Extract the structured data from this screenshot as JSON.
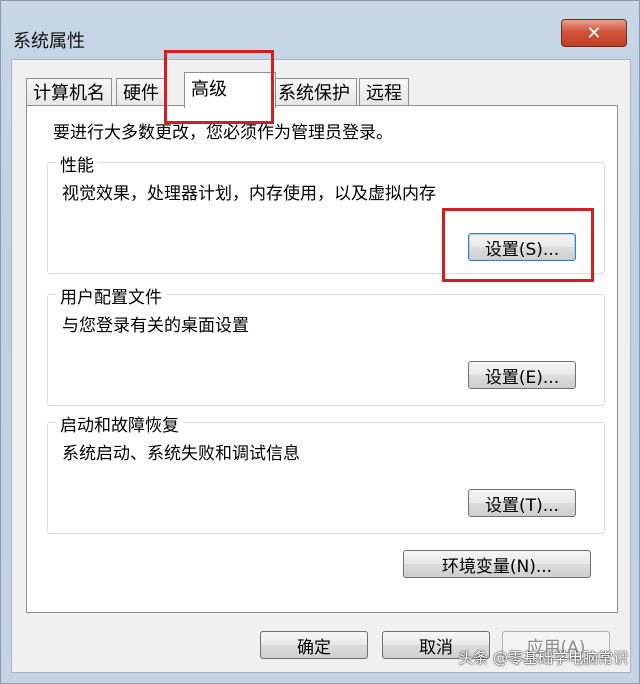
{
  "window": {
    "title": "系统属性",
    "close_glyph": "✕"
  },
  "tabs": [
    {
      "label": "计算机名",
      "active": false
    },
    {
      "label": "硬件",
      "active": false
    },
    {
      "label": "高级",
      "active": true
    },
    {
      "label": "系统保护",
      "active": false
    },
    {
      "label": "远程",
      "active": false
    }
  ],
  "advanced": {
    "admin_note": "要进行大多数更改，您必须作为管理员登录。",
    "performance": {
      "title": "性能",
      "description": "视觉效果，处理器计划，内存使用，以及虚拟内存",
      "button_label": "设置(S)..."
    },
    "user_profiles": {
      "title": "用户配置文件",
      "description": "与您登录有关的桌面设置",
      "button_label": "设置(E)..."
    },
    "startup_recovery": {
      "title": "启动和故障恢复",
      "description": "系统启动、系统失败和调试信息",
      "button_label": "设置(T)..."
    },
    "env_vars_label": "环境变量(N)..."
  },
  "footer": {
    "ok_label": "确定",
    "cancel_label": "取消",
    "apply_label": "应用(A)"
  },
  "watermark": "头条 @零基础学电脑常识",
  "colors": {
    "highlight": "#d31f1f",
    "close_button": "#c13f24"
  }
}
